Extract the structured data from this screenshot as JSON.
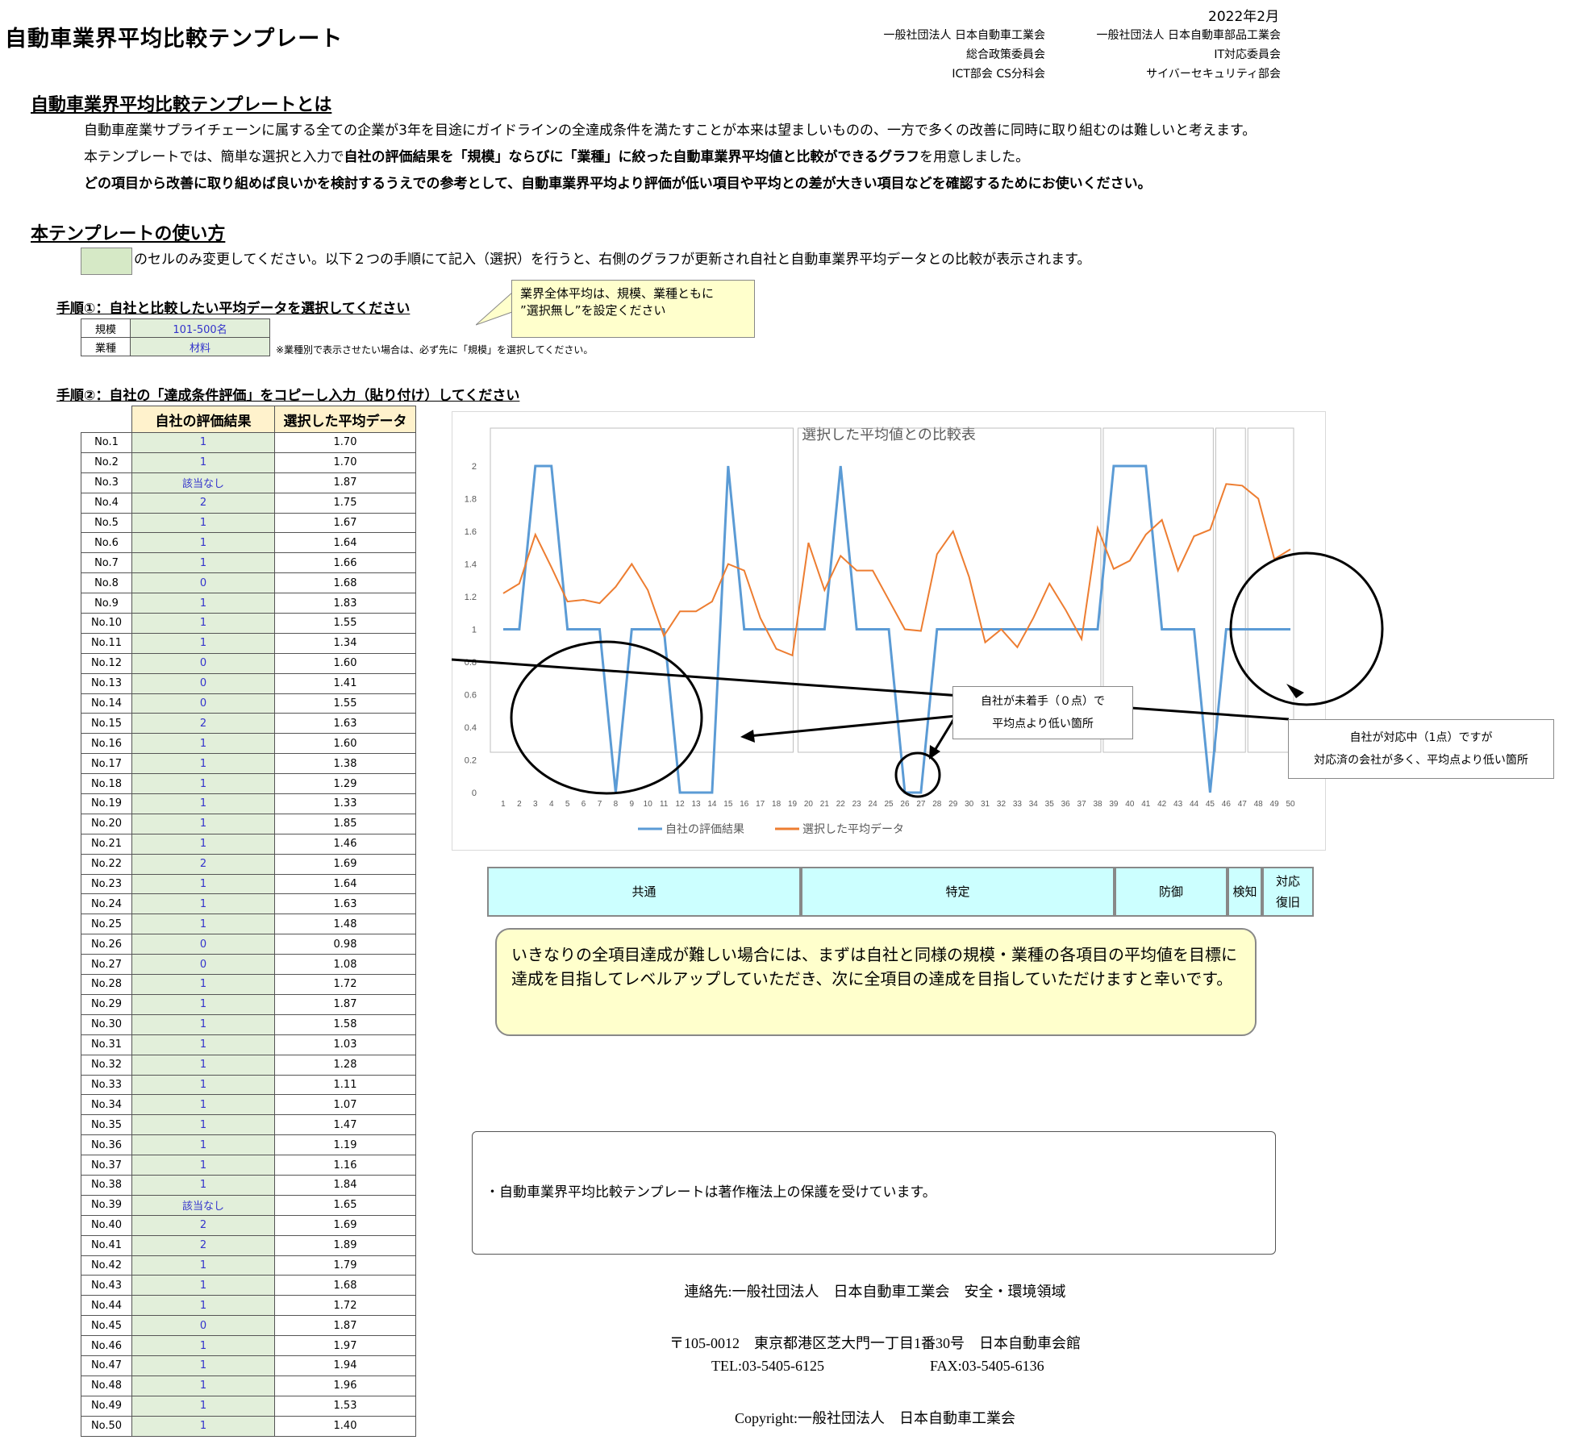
{
  "title": "自動車業界平均比較テンプレート",
  "date": "2022年2月",
  "org_left": [
    "一般社団法人 日本自動車工業会",
    "総合政策委員会",
    "ICT部会 CS分科会"
  ],
  "org_right": [
    "一般社団法人 日本自動車部品工業会",
    "IT対応委員会",
    "サイバーセキュリティ部会"
  ],
  "about": {
    "heading": "自動車業界平均比較テンプレートとは",
    "line1": "自動車産業サプライチェーンに属する全ての企業が3年を目途にガイドラインの全達成条件を満たすことが本来は望ましいものの、一方で多くの改善に同時に取り組むのは難しいと考えます。",
    "line2_a": "本テンプレートでは、簡単な選択と入力で",
    "line2_b": "自社の評価結果を「規模」ならびに「業種」に絞った自動車業界平均値と比較ができるグラフ",
    "line2_c": "を用意しました。",
    "line3": "どの項目から改善に取り組めば良いかを検討するうえでの参考として、自動車業界平均より評価が低い項目や平均との差が大きい項目などを確認するためにお使いください。"
  },
  "usage": {
    "heading": "本テンプレートの使い方",
    "instruction": "のセルのみ変更してください。以下２つの手順にて記入（選択）を行うと、右側のグラフが更新され自社と自動車業界平均データとの比較が表示されます。"
  },
  "step1": {
    "heading": "手順①：自社と比較したい平均データを選択してください",
    "scale_label": "規模",
    "scale_value": "101-500名",
    "industry_label": "業種",
    "industry_value": "材料",
    "note": "※業種別で表示させたい場合は、必ず先に「規模」を選択してください。",
    "callout": "業界全体平均は、規模、業種ともに\n”選択無し”を設定ください"
  },
  "step2": {
    "heading": "手順②：自社の「達成条件評価」をコピーし入力（貼り付け）してください",
    "col_self": "自社の評価結果",
    "col_avg": "選択した平均データ"
  },
  "rows": [
    {
      "no": "No.1",
      "self": "1",
      "avg": "1.70"
    },
    {
      "no": "No.2",
      "self": "1",
      "avg": "1.70"
    },
    {
      "no": "No.3",
      "self": "該当なし",
      "avg": "1.87"
    },
    {
      "no": "No.4",
      "self": "2",
      "avg": "1.75"
    },
    {
      "no": "No.5",
      "self": "1",
      "avg": "1.67"
    },
    {
      "no": "No.6",
      "self": "1",
      "avg": "1.64"
    },
    {
      "no": "No.7",
      "self": "1",
      "avg": "1.66"
    },
    {
      "no": "No.8",
      "self": "0",
      "avg": "1.68"
    },
    {
      "no": "No.9",
      "self": "1",
      "avg": "1.83"
    },
    {
      "no": "No.10",
      "self": "1",
      "avg": "1.55"
    },
    {
      "no": "No.11",
      "self": "1",
      "avg": "1.34"
    },
    {
      "no": "No.12",
      "self": "0",
      "avg": "1.60"
    },
    {
      "no": "No.13",
      "self": "0",
      "avg": "1.41"
    },
    {
      "no": "No.14",
      "self": "0",
      "avg": "1.55"
    },
    {
      "no": "No.15",
      "self": "2",
      "avg": "1.63"
    },
    {
      "no": "No.16",
      "self": "1",
      "avg": "1.60"
    },
    {
      "no": "No.17",
      "self": "1",
      "avg": "1.38"
    },
    {
      "no": "No.18",
      "self": "1",
      "avg": "1.29"
    },
    {
      "no": "No.19",
      "self": "1",
      "avg": "1.33"
    },
    {
      "no": "No.20",
      "self": "1",
      "avg": "1.85"
    },
    {
      "no": "No.21",
      "self": "1",
      "avg": "1.46"
    },
    {
      "no": "No.22",
      "self": "2",
      "avg": "1.69"
    },
    {
      "no": "No.23",
      "self": "1",
      "avg": "1.64"
    },
    {
      "no": "No.24",
      "self": "1",
      "avg": "1.63"
    },
    {
      "no": "No.25",
      "self": "1",
      "avg": "1.48"
    },
    {
      "no": "No.26",
      "self": "0",
      "avg": "0.98"
    },
    {
      "no": "No.27",
      "self": "0",
      "avg": "1.08"
    },
    {
      "no": "No.28",
      "self": "1",
      "avg": "1.72"
    },
    {
      "no": "No.29",
      "self": "1",
      "avg": "1.87"
    },
    {
      "no": "No.30",
      "self": "1",
      "avg": "1.58"
    },
    {
      "no": "No.31",
      "self": "1",
      "avg": "1.03"
    },
    {
      "no": "No.32",
      "self": "1",
      "avg": "1.28"
    },
    {
      "no": "No.33",
      "self": "1",
      "avg": "1.11"
    },
    {
      "no": "No.34",
      "self": "1",
      "avg": "1.07"
    },
    {
      "no": "No.35",
      "self": "1",
      "avg": "1.47"
    },
    {
      "no": "No.36",
      "self": "1",
      "avg": "1.19"
    },
    {
      "no": "No.37",
      "self": "1",
      "avg": "1.16"
    },
    {
      "no": "No.38",
      "self": "1",
      "avg": "1.84"
    },
    {
      "no": "No.39",
      "self": "該当なし",
      "avg": "1.65"
    },
    {
      "no": "No.40",
      "self": "2",
      "avg": "1.69"
    },
    {
      "no": "No.41",
      "self": "2",
      "avg": "1.89"
    },
    {
      "no": "No.42",
      "self": "1",
      "avg": "1.79"
    },
    {
      "no": "No.43",
      "self": "1",
      "avg": "1.68"
    },
    {
      "no": "No.44",
      "self": "1",
      "avg": "1.72"
    },
    {
      "no": "No.45",
      "self": "0",
      "avg": "1.87"
    },
    {
      "no": "No.46",
      "self": "1",
      "avg": "1.97"
    },
    {
      "no": "No.47",
      "self": "1",
      "avg": "1.94"
    },
    {
      "no": "No.48",
      "self": "1",
      "avg": "1.96"
    },
    {
      "no": "No.49",
      "self": "1",
      "avg": "1.53"
    },
    {
      "no": "No.50",
      "self": "1",
      "avg": "1.40"
    }
  ],
  "chart_data": {
    "type": "line",
    "title": "選択した平均値との比較表",
    "x": [
      1,
      2,
      3,
      4,
      5,
      6,
      7,
      8,
      9,
      10,
      11,
      12,
      13,
      14,
      15,
      16,
      17,
      18,
      19,
      20,
      21,
      22,
      23,
      24,
      25,
      26,
      27,
      28,
      29,
      30,
      31,
      32,
      33,
      34,
      35,
      36,
      37,
      38,
      39,
      40,
      41,
      42,
      43,
      44,
      45,
      46,
      47,
      48,
      49,
      50
    ],
    "ylim": [
      0,
      2
    ],
    "yticks": [
      "0",
      "0.2",
      "0.4",
      "0.6",
      "0.8",
      "1",
      "1.2",
      "1.4",
      "1.6",
      "1.8",
      "2"
    ],
    "series": [
      {
        "name": "自社の評価結果",
        "color": "#5b9bd5",
        "values": [
          1,
          1,
          2,
          2,
          1,
          1,
          1,
          0,
          1,
          1,
          1,
          0,
          0,
          0,
          2,
          1,
          1,
          1,
          1,
          1,
          1,
          2,
          1,
          1,
          1,
          0,
          0,
          1,
          1,
          1,
          1,
          1,
          1,
          1,
          1,
          1,
          1,
          1,
          2,
          2,
          2,
          1,
          1,
          1,
          0,
          1,
          1,
          1,
          1,
          1
        ]
      },
      {
        "name": "選択した平均データ",
        "color": "#ed7d31",
        "values": [
          1.22,
          1.28,
          1.58,
          1.38,
          1.17,
          1.18,
          1.16,
          1.26,
          1.4,
          1.24,
          0.96,
          1.11,
          1.11,
          1.17,
          1.4,
          1.36,
          1.07,
          0.88,
          0.84,
          1.53,
          1.24,
          1.45,
          1.36,
          1.36,
          1.18,
          1.0,
          0.99,
          1.46,
          1.6,
          1.32,
          0.92,
          1.0,
          0.89,
          1.07,
          1.28,
          1.12,
          0.94,
          1.62,
          1.37,
          1.42,
          1.58,
          1.67,
          1.36,
          1.57,
          1.61,
          1.89,
          1.88,
          1.8,
          1.43,
          1.49
        ]
      }
    ],
    "categories_band": [
      {
        "label": "共通"
      },
      {
        "label": "特定"
      },
      {
        "label": "防御"
      },
      {
        "label": "検知"
      },
      {
        "label": "対応\n復旧"
      }
    ],
    "annotation_1": "自社が未着手（０点）で\n平均点より低い箇所",
    "annotation_2": "自社が対応中（1点）ですが\n対応済の会社が多く、平均点より低い箇所",
    "grid": true,
    "legend": "bottom"
  },
  "advice": "いきなりの全項目達成が難しい場合には、まずは自社と同様の規模・業種の各項目の平均値を目標に達成を目指してレベルアップしていただき、次に全項目の達成を目指していただけますと幸いです。",
  "copyright_note": "・自動車業界平均比較テンプレートは著作権法上の保護を受けています。",
  "footer": {
    "contact": "連絡先:一般社団法人　日本自動車工業会　安全・環境領域",
    "address": "〒105-0012　東京都港区芝大門一丁目1番30号　日本自動車会館",
    "tel": "TEL:03-5405-6125",
    "fax": "FAX:03-5405-6136",
    "copyright": "Copyright:一般社団法人　日本自動車工業会"
  }
}
